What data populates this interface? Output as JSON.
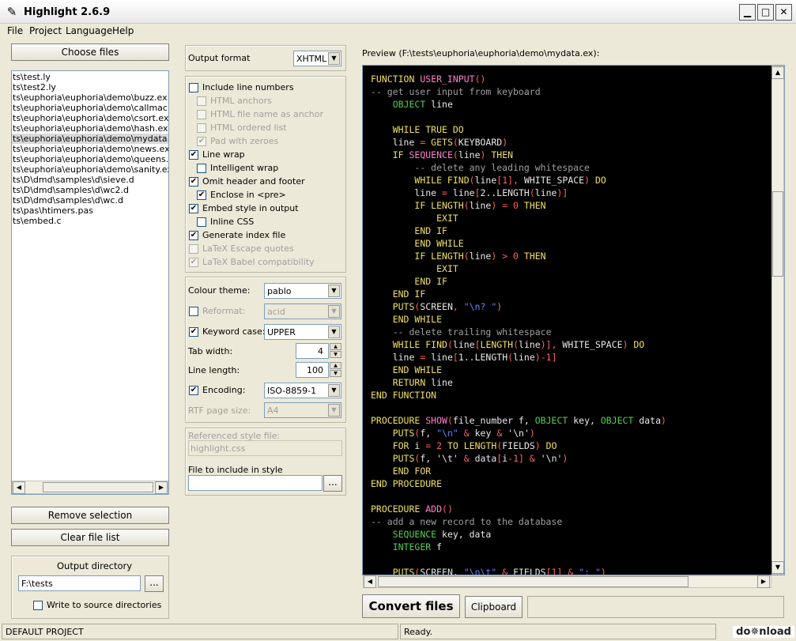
{
  "app": {
    "title": "Highlight 2.6.9"
  },
  "window_controls": {
    "minimize": "▁",
    "maximize": "□",
    "close": "✕"
  },
  "menu": [
    "File",
    "Project",
    "Language",
    "Help"
  ],
  "left": {
    "choose_files": "Choose files",
    "files": [
      "ts\\test.ly",
      "ts\\test2.ly",
      "ts\\euphoria\\euphoria\\demo\\buzz.ex",
      "ts\\euphoria\\euphoria\\demo\\callmach.ex",
      "ts\\euphoria\\euphoria\\demo\\csort.ex",
      "ts\\euphoria\\euphoria\\demo\\hash.ex",
      "ts\\euphoria\\euphoria\\demo\\mydata.ex",
      "ts\\euphoria\\euphoria\\demo\\news.exu",
      "ts\\euphoria\\euphoria\\demo\\queens.ex",
      "ts\\euphoria\\euphoria\\demo\\sanity.ex",
      "ts\\D\\dmd\\samples\\d\\sieve.d",
      "ts\\D\\dmd\\samples\\d\\wc2.d",
      "ts\\D\\dmd\\samples\\d\\wc.d",
      "ts\\pas\\htimers.pas",
      "ts\\embed.c"
    ],
    "selected_index": 6,
    "remove_selection": "Remove selection",
    "clear_file_list": "Clear file list",
    "output_directory_label": "Output directory",
    "output_directory_value": "F:\\tests",
    "browse": "...",
    "write_to_source": "Write to source directories"
  },
  "middle": {
    "output_format_label": "Output format",
    "output_format_value": "XHTML",
    "options": [
      {
        "label": "Include line numbers",
        "checked": false,
        "disabled": false,
        "indent": 0
      },
      {
        "label": "HTML anchors",
        "checked": false,
        "disabled": true,
        "indent": 1
      },
      {
        "label": "HTML file name as anchor",
        "checked": false,
        "disabled": true,
        "indent": 1
      },
      {
        "label": "HTML ordered list",
        "checked": false,
        "disabled": true,
        "indent": 1
      },
      {
        "label": "Pad with zeroes",
        "checked": true,
        "disabled": true,
        "indent": 1
      },
      {
        "label": "Line wrap",
        "checked": true,
        "disabled": false,
        "indent": 0
      },
      {
        "label": "Intelligent wrap",
        "checked": false,
        "disabled": false,
        "indent": 1
      },
      {
        "label": "Omit header and footer",
        "checked": true,
        "disabled": false,
        "indent": 0
      },
      {
        "label": "Enclose in <pre>",
        "checked": true,
        "disabled": false,
        "indent": 1
      },
      {
        "label": "Embed style in output",
        "checked": true,
        "disabled": false,
        "indent": 0
      },
      {
        "label": "Inline CSS",
        "checked": false,
        "disabled": false,
        "indent": 1
      },
      {
        "label": "Generate index file",
        "checked": true,
        "disabled": false,
        "indent": 0
      },
      {
        "label": "LaTeX Escape quotes",
        "checked": false,
        "disabled": true,
        "indent": 0
      },
      {
        "label": "LaTeX Babel compatibility",
        "checked": true,
        "disabled": true,
        "indent": 0
      }
    ],
    "colour_theme_label": "Colour theme:",
    "colour_theme_value": "pablo",
    "reformat_label": "Reformat:",
    "reformat_value": "acid",
    "keyword_case_label": "Keyword case:",
    "keyword_case_value": "UPPER",
    "tab_width_label": "Tab width:",
    "tab_width_value": "4",
    "line_length_label": "Line length:",
    "line_length_value": "100",
    "encoding_label": "Encoding:",
    "encoding_value": "ISO-8859-1",
    "rtf_page_size_label": "RTF page size:",
    "rtf_page_size_value": "A4",
    "referenced_style_label": "Referenced style file:",
    "referenced_style_value": "highlight.css",
    "file_include_label": "File to include in style",
    "file_include_browse": "..."
  },
  "preview": {
    "label": "Preview (F:\\tests\\euphoria\\euphoria\\demo\\mydata.ex):",
    "lines": [
      [
        [
          "kw",
          "FUNCTION "
        ],
        [
          "fn",
          "USER_INPUT"
        ],
        [
          "op",
          "()"
        ]
      ],
      [
        [
          "cm",
          "-- get user input from keyboard"
        ]
      ],
      [
        [
          "tx",
          "    "
        ],
        [
          "ty",
          "OBJECT"
        ],
        [
          "tx",
          " line"
        ]
      ],
      [
        [
          "tx",
          ""
        ]
      ],
      [
        [
          "tx",
          "    "
        ],
        [
          "kw",
          "WHILE TRUE DO"
        ]
      ],
      [
        [
          "tx",
          "    line "
        ],
        [
          "op",
          "="
        ],
        [
          "kw",
          " GETS"
        ],
        [
          "op",
          "("
        ],
        [
          "tx",
          "KEYBOARD"
        ],
        [
          "op",
          ")"
        ]
      ],
      [
        [
          "tx",
          "    "
        ],
        [
          "kw",
          "IF "
        ],
        [
          "fn",
          "SEQUENCE"
        ],
        [
          "op",
          "("
        ],
        [
          "tx",
          "line"
        ],
        [
          "op",
          ")"
        ],
        [
          "kw",
          " THEN"
        ]
      ],
      [
        [
          "tx",
          "        "
        ],
        [
          "cm",
          "-- delete any leading whitespace"
        ]
      ],
      [
        [
          "tx",
          "        "
        ],
        [
          "kw",
          "WHILE FIND"
        ],
        [
          "op",
          "("
        ],
        [
          "tx",
          "line"
        ],
        [
          "op",
          "["
        ],
        [
          "nu",
          "1"
        ],
        [
          "op",
          "],"
        ],
        [
          "tx",
          " WHITE_SPACE"
        ],
        [
          "op",
          ")"
        ],
        [
          "kw",
          " DO"
        ]
      ],
      [
        [
          "tx",
          "        line "
        ],
        [
          "op",
          "="
        ],
        [
          "tx",
          " line"
        ],
        [
          "op",
          "["
        ],
        [
          "tx",
          "2..LENGTH"
        ],
        [
          "op",
          "("
        ],
        [
          "tx",
          "line"
        ],
        [
          "op",
          ")]"
        ]
      ],
      [
        [
          "tx",
          "        "
        ],
        [
          "kw",
          "IF LENGTH"
        ],
        [
          "op",
          "("
        ],
        [
          "tx",
          "line"
        ],
        [
          "op",
          ") = "
        ],
        [
          "nu",
          "0"
        ],
        [
          "kw",
          " THEN"
        ]
      ],
      [
        [
          "tx",
          "            "
        ],
        [
          "kw",
          "EXIT"
        ]
      ],
      [
        [
          "tx",
          "        "
        ],
        [
          "kw",
          "END IF"
        ]
      ],
      [
        [
          "tx",
          "        "
        ],
        [
          "kw",
          "END WHILE"
        ]
      ],
      [
        [
          "tx",
          "        "
        ],
        [
          "kw",
          "IF LENGTH"
        ],
        [
          "op",
          "("
        ],
        [
          "tx",
          "line"
        ],
        [
          "op",
          ") > "
        ],
        [
          "nu",
          "0"
        ],
        [
          "kw",
          " THEN"
        ]
      ],
      [
        [
          "tx",
          "            "
        ],
        [
          "kw",
          "EXIT"
        ]
      ],
      [
        [
          "tx",
          "        "
        ],
        [
          "kw",
          "END IF"
        ]
      ],
      [
        [
          "tx",
          "    "
        ],
        [
          "kw",
          "END IF"
        ]
      ],
      [
        [
          "tx",
          "    "
        ],
        [
          "kw",
          "PUTS"
        ],
        [
          "op",
          "("
        ],
        [
          "tx",
          "SCREEN"
        ],
        [
          "op",
          ", "
        ],
        [
          "st",
          "\"\\n? \""
        ],
        [
          "op",
          ")"
        ]
      ],
      [
        [
          "tx",
          "    "
        ],
        [
          "kw",
          "END WHILE"
        ]
      ],
      [
        [
          "tx",
          "    "
        ],
        [
          "cm",
          "-- delete trailing whitespace"
        ]
      ],
      [
        [
          "tx",
          "    "
        ],
        [
          "kw",
          "WHILE FIND"
        ],
        [
          "op",
          "("
        ],
        [
          "tx",
          "line"
        ],
        [
          "op",
          "["
        ],
        [
          "kw",
          "LENGTH"
        ],
        [
          "op",
          "("
        ],
        [
          "tx",
          "line"
        ],
        [
          "op",
          ")],"
        ],
        [
          "tx",
          " WHITE_SPACE"
        ],
        [
          "op",
          ")"
        ],
        [
          "kw",
          " DO"
        ]
      ],
      [
        [
          "tx",
          "    line "
        ],
        [
          "op",
          "="
        ],
        [
          "tx",
          " line"
        ],
        [
          "op",
          "["
        ],
        [
          "tx",
          "1..LENGTH"
        ],
        [
          "op",
          "("
        ],
        [
          "tx",
          "line"
        ],
        [
          "op",
          ")-"
        ],
        [
          "nu",
          "1"
        ],
        [
          "op",
          "]"
        ]
      ],
      [
        [
          "tx",
          "    "
        ],
        [
          "kw",
          "END WHILE"
        ]
      ],
      [
        [
          "tx",
          "    "
        ],
        [
          "kw",
          "RETURN"
        ],
        [
          "tx",
          " line"
        ]
      ],
      [
        [
          "kw",
          "END FUNCTION"
        ]
      ],
      [
        [
          "tx",
          ""
        ]
      ],
      [
        [
          "kw",
          "PROCEDURE "
        ],
        [
          "fn",
          "SHOW"
        ],
        [
          "op",
          "("
        ],
        [
          "tx",
          "file_number f, "
        ],
        [
          "ty",
          "OBJECT"
        ],
        [
          "tx",
          " key, "
        ],
        [
          "ty",
          "OBJECT"
        ],
        [
          "tx",
          " data"
        ],
        [
          "op",
          ")"
        ]
      ],
      [
        [
          "tx",
          "    "
        ],
        [
          "kw",
          "PUTS"
        ],
        [
          "op",
          "("
        ],
        [
          "tx",
          "f, "
        ],
        [
          "st",
          "\"\\n\""
        ],
        [
          "op",
          " & "
        ],
        [
          "tx",
          "key "
        ],
        [
          "op",
          "& "
        ],
        [
          "tx",
          "'\\n'"
        ],
        [
          "op",
          ")"
        ]
      ],
      [
        [
          "tx",
          "    "
        ],
        [
          "kw",
          "FOR"
        ],
        [
          "tx",
          " i "
        ],
        [
          "op",
          "="
        ],
        [
          "nu",
          " 2"
        ],
        [
          "kw",
          " TO LENGTH"
        ],
        [
          "op",
          "("
        ],
        [
          "tx",
          "FIELDS"
        ],
        [
          "op",
          ")"
        ],
        [
          "kw",
          " DO"
        ]
      ],
      [
        [
          "tx",
          "    "
        ],
        [
          "kw",
          "PUTS"
        ],
        [
          "op",
          "("
        ],
        [
          "tx",
          "f, '\\t' "
        ],
        [
          "op",
          "&"
        ],
        [
          "tx",
          " data"
        ],
        [
          "op",
          "["
        ],
        [
          "tx",
          "i"
        ],
        [
          "op",
          "-"
        ],
        [
          "nu",
          "1"
        ],
        [
          "op",
          "] &"
        ],
        [
          "tx",
          " '\\n'"
        ],
        [
          "op",
          ")"
        ]
      ],
      [
        [
          "tx",
          "    "
        ],
        [
          "kw",
          "END FOR"
        ]
      ],
      [
        [
          "kw",
          "END PROCEDURE"
        ]
      ],
      [
        [
          "tx",
          ""
        ]
      ],
      [
        [
          "kw",
          "PROCEDURE "
        ],
        [
          "fn",
          "ADD"
        ],
        [
          "op",
          "()"
        ]
      ],
      [
        [
          "cm",
          "-- add a new record to the database"
        ]
      ],
      [
        [
          "tx",
          "    "
        ],
        [
          "ty",
          "SEQUENCE"
        ],
        [
          "tx",
          " key, data"
        ]
      ],
      [
        [
          "tx",
          "    "
        ],
        [
          "ty",
          "INTEGER"
        ],
        [
          "tx",
          " f"
        ]
      ],
      [
        [
          "tx",
          ""
        ]
      ],
      [
        [
          "tx",
          "    "
        ],
        [
          "kw",
          "PUTS"
        ],
        [
          "op",
          "("
        ],
        [
          "tx",
          "SCREEN, "
        ],
        [
          "st",
          "\"\\n\\t\""
        ],
        [
          "op",
          " & "
        ],
        [
          "tx",
          "FIELDS"
        ],
        [
          "op",
          "["
        ],
        [
          "nu",
          "1"
        ],
        [
          "op",
          "] & "
        ],
        [
          "st",
          "\": \""
        ],
        [
          "op",
          ")"
        ]
      ]
    ],
    "convert": "Convert files",
    "clipboard": "Clipboard"
  },
  "status": {
    "project": "DEFAULT PROJECT",
    "state": "Ready."
  },
  "watermark": "do✵nload"
}
